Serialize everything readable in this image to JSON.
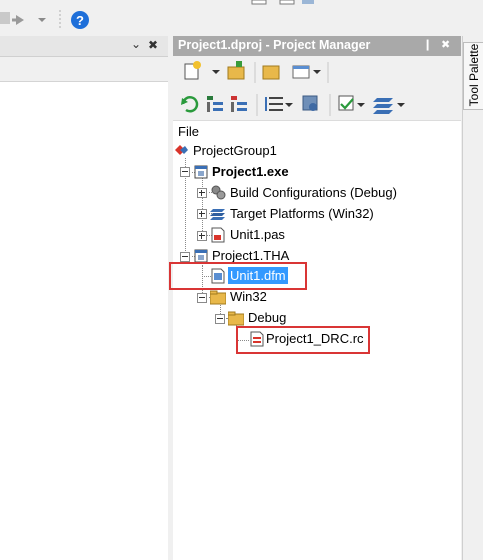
{
  "project_manager": {
    "title": "Project1.dproj - Project Manager",
    "pin_glyph": "❙",
    "close_glyph": "✖"
  },
  "left_panel": {
    "dropdown_glyph": "⌄",
    "close_glyph": "✖"
  },
  "tool_palette": {
    "label": "Tool Palette"
  },
  "tree": {
    "header": "File",
    "items": [
      {
        "label": "ProjectGroup1"
      },
      {
        "label": "Project1.exe"
      },
      {
        "label": "Build Configurations (Debug)"
      },
      {
        "label": "Target Platforms (Win32)"
      },
      {
        "label": "Unit1.pas"
      },
      {
        "label": "Project1.THA"
      },
      {
        "label": "Unit1.dfm"
      },
      {
        "label": "Win32"
      },
      {
        "label": "Debug"
      },
      {
        "label": "Project1_DRC.rc"
      }
    ]
  },
  "colors": {
    "selection": "#3399ff",
    "annotation_box": "#d93535",
    "title_bar": "#a9a9a9"
  }
}
